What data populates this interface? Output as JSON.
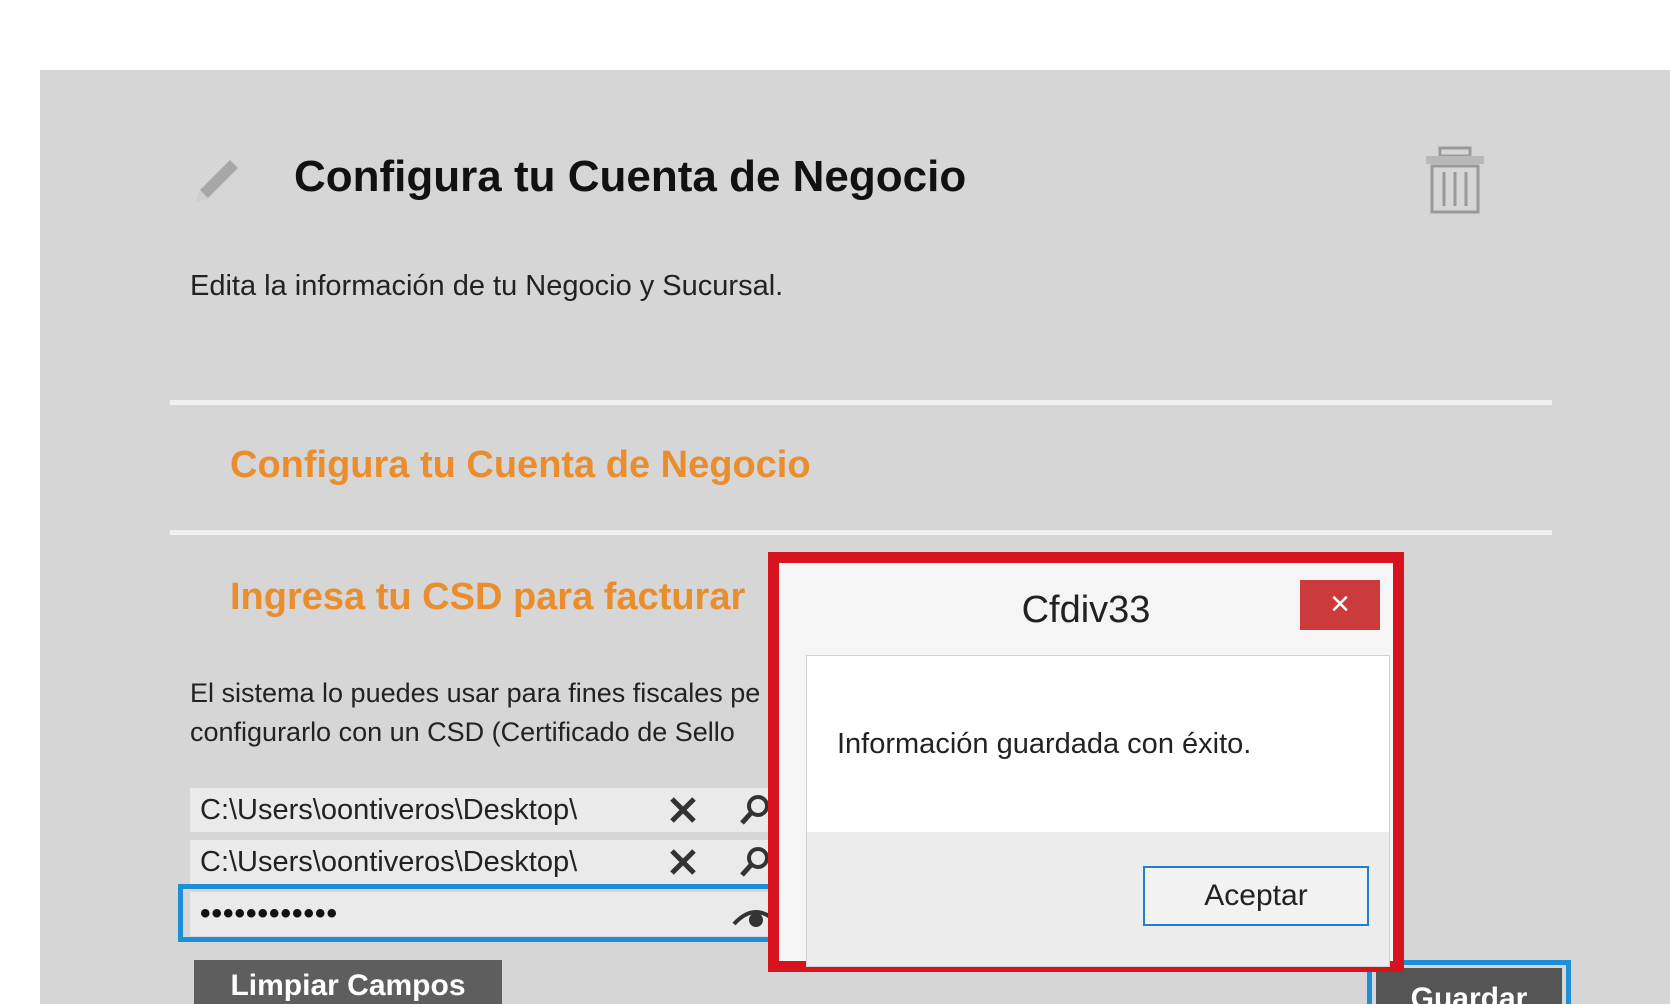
{
  "header": {
    "title": "Configura tu Cuenta de Negocio",
    "subtitle": "Edita la información de tu Negocio y Sucursal."
  },
  "sections": {
    "account": "Configura tu Cuenta de Negocio",
    "csd": "Ingresa tu CSD para facturar"
  },
  "description": {
    "line1": "El sistema lo puedes usar para fines fiscales pe",
    "line2": "configurarlo con un CSD (Certificado de Sello"
  },
  "fields": {
    "cer_path": "C:\\Users\\oontiveros\\Desktop\\",
    "key_path": "C:\\Users\\oontiveros\\Desktop\\",
    "password_mask": "••••••••••••"
  },
  "buttons": {
    "clear": "Limpiar Campos",
    "save": "Guardar"
  },
  "dialog": {
    "title": "Cfdiv33",
    "close": "×",
    "message": "Información guardada con éxito.",
    "ok": "Aceptar"
  },
  "colors": {
    "accent_orange": "#ea8d2c",
    "highlight_red": "#d7131f",
    "focus_blue": "#1d8fd9"
  },
  "icons": [
    "pencil-icon",
    "trash-icon",
    "clear-x-icon",
    "search-icon",
    "eye-icon",
    "close-icon"
  ]
}
